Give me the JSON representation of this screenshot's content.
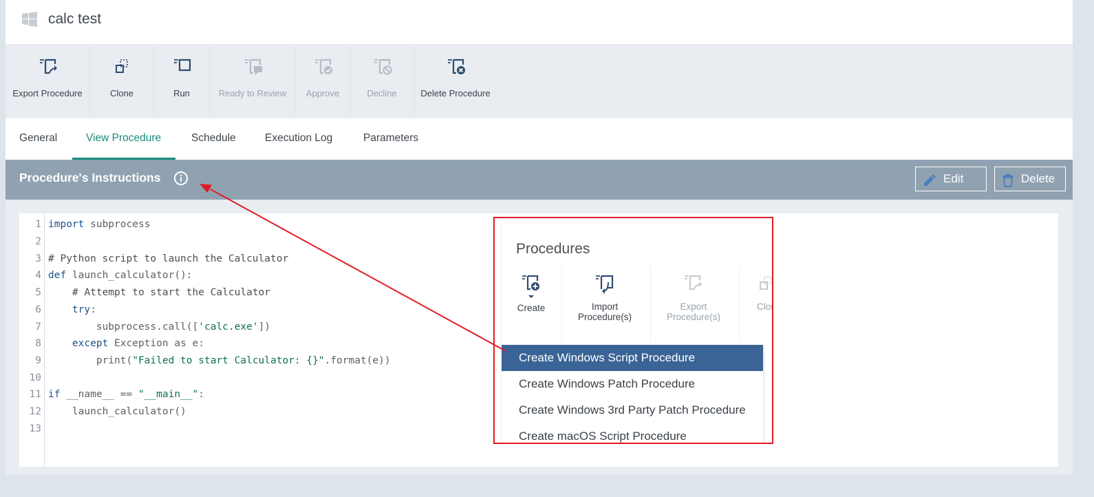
{
  "header": {
    "title": "calc test",
    "icon": "windows-icon"
  },
  "toolbar": {
    "buttons": [
      {
        "label": "Export Procedure",
        "icon": "export-procedure-icon",
        "enabled": true
      },
      {
        "label": "Clone",
        "icon": "clone-icon",
        "enabled": true
      },
      {
        "label": "Run",
        "icon": "run-icon",
        "enabled": true
      },
      {
        "label": "Ready to Review",
        "icon": "ready-to-review-icon",
        "enabled": false
      },
      {
        "label": "Approve",
        "icon": "approve-icon",
        "enabled": false
      },
      {
        "label": "Decline",
        "icon": "decline-icon",
        "enabled": false
      },
      {
        "label": "Delete Procedure",
        "icon": "delete-procedure-icon",
        "enabled": true
      }
    ]
  },
  "tabs": {
    "items": [
      "General",
      "View Procedure",
      "Schedule",
      "Execution Log",
      "Parameters"
    ],
    "active": "View Procedure"
  },
  "section": {
    "title": "Procedure's Instructions",
    "edit_label": "Edit",
    "delete_label": "Delete"
  },
  "code": {
    "line_numbers": [
      "1",
      "2",
      "3",
      "4",
      "5",
      "6",
      "7",
      "8",
      "9",
      "10",
      "11",
      "12",
      "13"
    ],
    "lines": [
      "import subprocess",
      "",
      "# Python script to launch the Calculator",
      "def launch_calculator():",
      "    # Attempt to start the Calculator",
      "    try:",
      "        subprocess.call(['calc.exe'])",
      "    except Exception as e:",
      "        print(\"Failed to start Calculator: {}\".format(e))",
      "",
      "if __name__ == \"__main__\":",
      "    launch_calculator()",
      ""
    ]
  },
  "inset": {
    "title": "Procedures",
    "buttons": [
      {
        "label": "Create",
        "icon": "create-procedure-icon",
        "enabled": true
      },
      {
        "label": "Import Procedure(s)",
        "icon": "import-procedure-icon",
        "enabled": true
      },
      {
        "label": "Export Procedure(s)",
        "icon": "export-procedures-icon",
        "enabled": false
      },
      {
        "label": "Clon",
        "icon": "clone-icon",
        "enabled": false
      }
    ],
    "menu": [
      "Create Windows Script Procedure",
      "Create Windows Patch Procedure",
      "Create Windows 3rd Party Patch Procedure",
      "Create macOS Script Procedure"
    ],
    "highlighted_item": "Create Windows Script Procedure"
  },
  "colors": {
    "accent": "#1a8b7a",
    "section_bar": "#90a2b2",
    "highlight": "#3a6496",
    "annotation": "#e01b24"
  }
}
